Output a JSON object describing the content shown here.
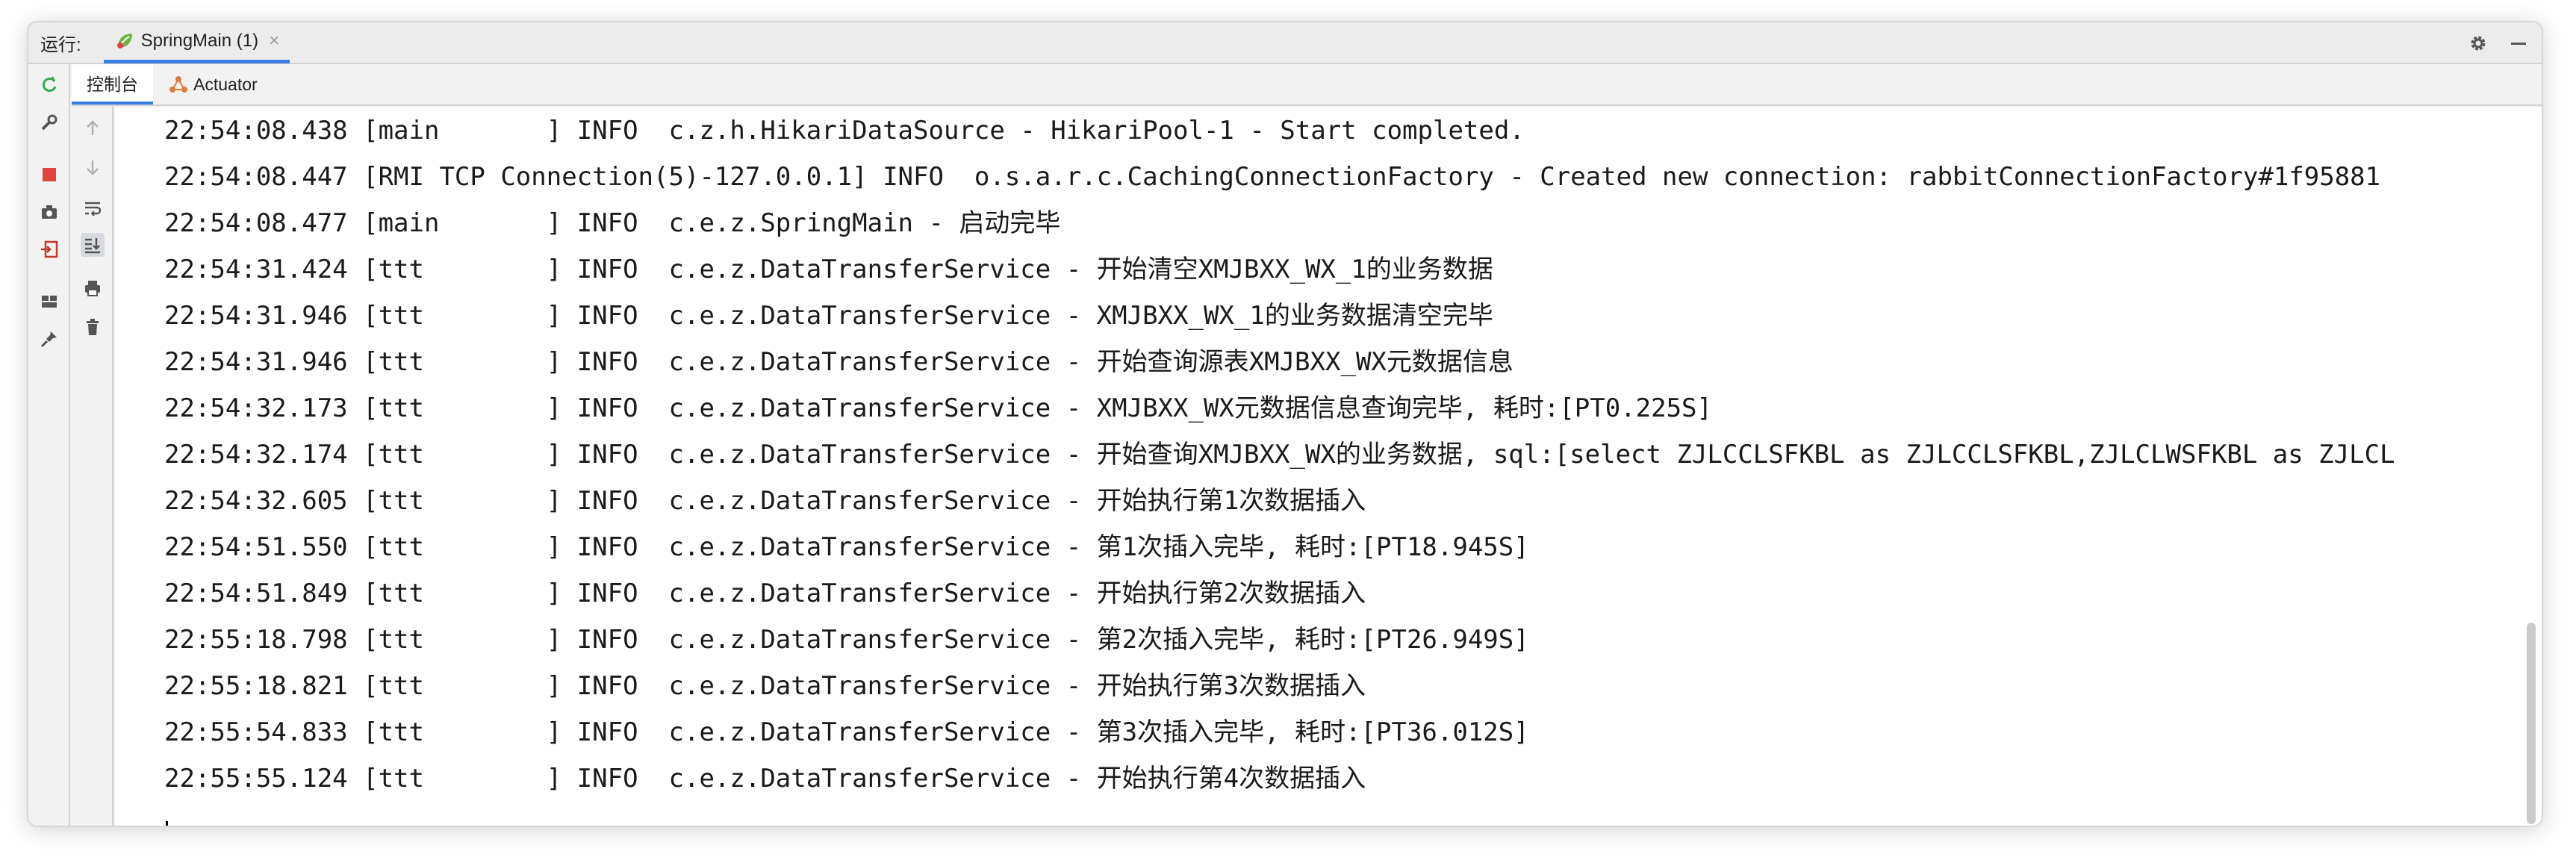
{
  "runbar": {
    "label": "运行:",
    "tab_label": "SpringMain (1)",
    "close_glyph": "×"
  },
  "subtabs": [
    {
      "label": "控制台",
      "active": true
    },
    {
      "label": "Actuator",
      "active": false
    }
  ],
  "icons": {
    "runbar_right": [
      "gear-icon",
      "minimize-icon"
    ],
    "left_toolbar": [
      "rerun-icon",
      "wrench-icon",
      "stop-icon",
      "camera-icon",
      "login-icon",
      "layout-icon",
      "pin-icon"
    ],
    "sub_toolbar": [
      "up-arrow-icon",
      "down-arrow-icon",
      "soft-wrap-icon",
      "scroll-to-end-icon",
      "print-icon",
      "trash-icon"
    ]
  },
  "colors": {
    "accent": "#3c7be0",
    "stop": "#e0443e",
    "rerun": "#3aa655",
    "spring": "#6db33f"
  },
  "console": {
    "lines": [
      "22:54:08.438 [main       ] INFO  c.z.h.HikariDataSource - HikariPool-1 - Start completed.",
      "22:54:08.447 [RMI TCP Connection(5)-127.0.0.1] INFO  o.s.a.r.c.CachingConnectionFactory - Created new connection: rabbitConnectionFactory#1f95881",
      "22:54:08.477 [main       ] INFO  c.e.z.SpringMain - 启动完毕",
      "22:54:31.424 [ttt        ] INFO  c.e.z.DataTransferService - 开始清空XMJBXX_WX_1的业务数据",
      "22:54:31.946 [ttt        ] INFO  c.e.z.DataTransferService - XMJBXX_WX_1的业务数据清空完毕",
      "22:54:31.946 [ttt        ] INFO  c.e.z.DataTransferService - 开始查询源表XMJBXX_WX元数据信息",
      "22:54:32.173 [ttt        ] INFO  c.e.z.DataTransferService - XMJBXX_WX元数据信息查询完毕, 耗时:[PT0.225S]",
      "22:54:32.174 [ttt        ] INFO  c.e.z.DataTransferService - 开始查询XMJBXX_WX的业务数据, sql:[select ZJLCCLSFKBL as ZJLCCLSFKBL,ZJLCLWSFKBL as ZJLCL",
      "22:54:32.605 [ttt        ] INFO  c.e.z.DataTransferService - 开始执行第1次数据插入",
      "22:54:51.550 [ttt        ] INFO  c.e.z.DataTransferService - 第1次插入完毕, 耗时:[PT18.945S]",
      "22:54:51.849 [ttt        ] INFO  c.e.z.DataTransferService - 开始执行第2次数据插入",
      "22:55:18.798 [ttt        ] INFO  c.e.z.DataTransferService - 第2次插入完毕, 耗时:[PT26.949S]",
      "22:55:18.821 [ttt        ] INFO  c.e.z.DataTransferService - 开始执行第3次数据插入",
      "22:55:54.833 [ttt        ] INFO  c.e.z.DataTransferService - 第3次插入完毕, 耗时:[PT36.012S]",
      "22:55:55.124 [ttt        ] INFO  c.e.z.DataTransferService - 开始执行第4次数据插入"
    ]
  }
}
